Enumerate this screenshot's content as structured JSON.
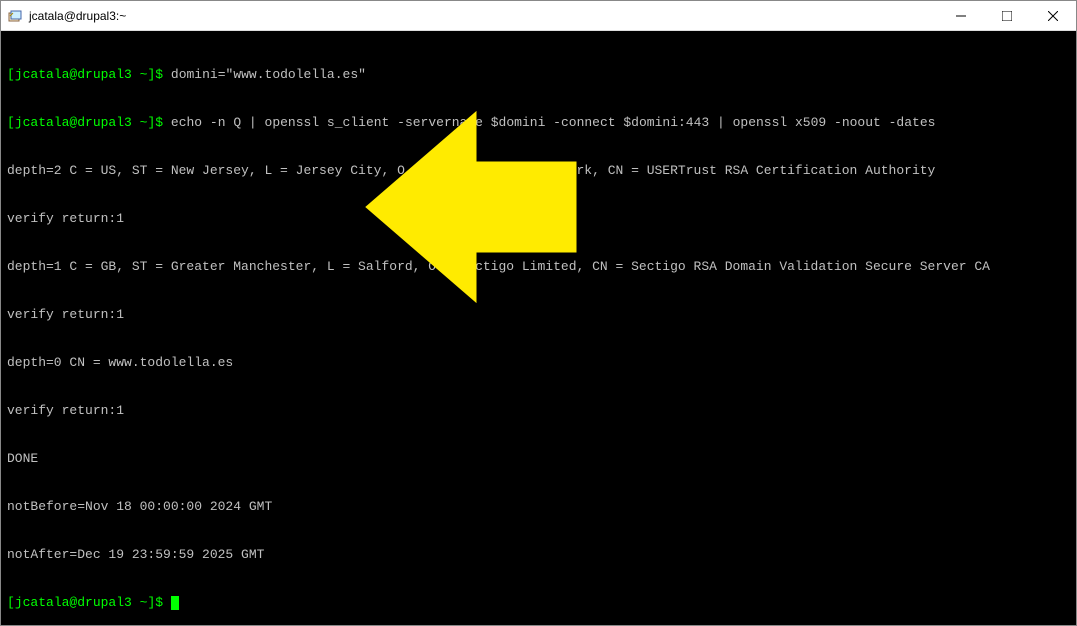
{
  "window": {
    "title": "jcatala@drupal3:~"
  },
  "terminal": {
    "prompt1": {
      "user": "jcatala@drupal3",
      "path": "~",
      "command": "domini=\"www.todolella.es\""
    },
    "prompt2": {
      "user": "jcatala@drupal3",
      "path": "~",
      "command": "echo -n Q | openssl s_client -servername $domini -connect $domini:443 | openssl x509 -noout -dates"
    },
    "output": {
      "line1": "depth=2 C = US, ST = New Jersey, L = Jersey City, O = The USERTRUST Network, CN = USERTrust RSA Certification Authority",
      "line2": "verify return:1",
      "line3": "depth=1 C = GB, ST = Greater Manchester, L = Salford, O = Sectigo Limited, CN = Sectigo RSA Domain Validation Secure Server CA",
      "line4": "verify return:1",
      "line5": "depth=0 CN = www.todolella.es",
      "line6": "verify return:1",
      "line7": "DONE",
      "line8": "notBefore=Nov 18 00:00:00 2024 GMT",
      "line9": "notAfter=Dec 19 23:59:59 2025 GMT"
    },
    "prompt3": {
      "user": "jcatala@drupal3",
      "path": "~"
    }
  }
}
